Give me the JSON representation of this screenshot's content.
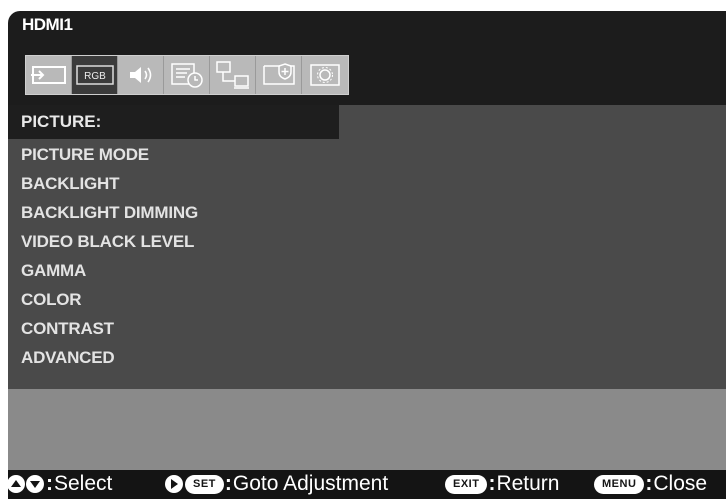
{
  "source": "HDMI1",
  "icons": [
    "input-icon",
    "rgb-icon",
    "audio-icon",
    "schedule-icon",
    "network-icon",
    "protect-icon",
    "system-icon"
  ],
  "menu": {
    "header": "PICTURE:",
    "items": [
      "PICTURE MODE",
      "BACKLIGHT",
      "BACKLIGHT DIMMING",
      "VIDEO BLACK LEVEL",
      "GAMMA",
      "COLOR",
      "CONTRAST",
      "ADVANCED"
    ]
  },
  "footer": {
    "select": "Select",
    "set_key": "SET",
    "goto": "Goto Adjustment",
    "exit_key": "EXIT",
    "return": "Return",
    "menu_key": "MENU",
    "close": "Close"
  },
  "colors": {
    "active_tab": "#3b3b3b",
    "content_bg": "#4a4a4a",
    "info_bg": "#8a8a8a",
    "footer_bg": "#141414"
  }
}
